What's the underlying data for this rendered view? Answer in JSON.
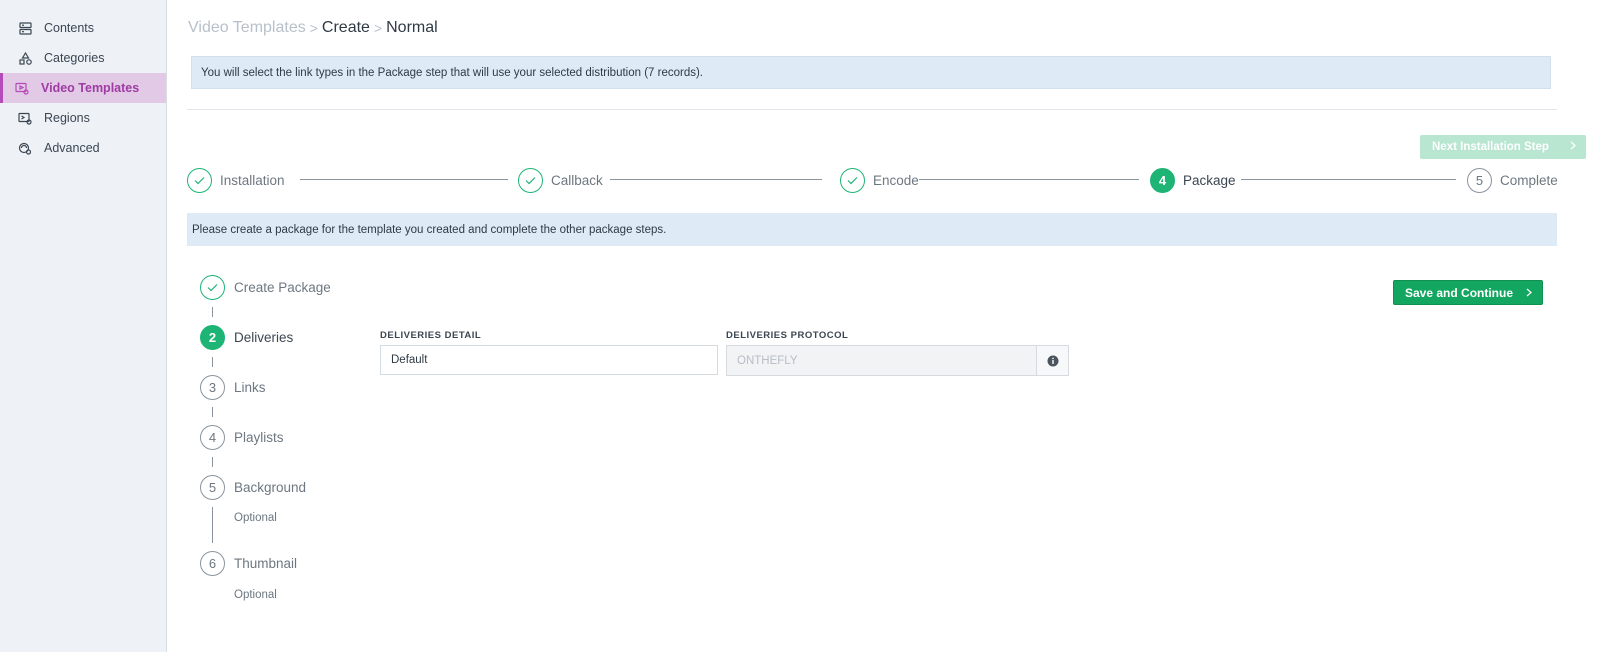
{
  "sidebar": {
    "items": [
      {
        "label": "Contents",
        "icon": "server-stack-icon"
      },
      {
        "label": "Categories",
        "icon": "shapes-icon"
      },
      {
        "label": "Video Templates",
        "icon": "video-settings-icon"
      },
      {
        "label": "Regions",
        "icon": "region-settings-icon"
      },
      {
        "label": "Advanced",
        "icon": "advanced-settings-icon"
      }
    ],
    "active_index": 2
  },
  "breadcrumb": {
    "level1": "Video Templates",
    "sep": ">",
    "level2": "Create",
    "level3": "Normal"
  },
  "info_banner": "You will select the link types in the Package step that will use your selected distribution (7 records).",
  "next_step_button": "Next Installation Step",
  "stepper": [
    {
      "label": "Installation",
      "state": "done"
    },
    {
      "label": "Callback",
      "state": "done"
    },
    {
      "label": "Encode",
      "state": "done"
    },
    {
      "label": "Package",
      "state": "active",
      "number": "4"
    },
    {
      "label": "Complete",
      "state": "pending",
      "number": "5"
    }
  ],
  "package_banner": "Please create a package for the template you created and complete the other package steps.",
  "substeps": [
    {
      "label": "Create Package",
      "state": "done"
    },
    {
      "label": "Deliveries",
      "state": "active",
      "number": "2"
    },
    {
      "label": "Links",
      "state": "pending",
      "number": "3"
    },
    {
      "label": "Playlists",
      "state": "pending",
      "number": "4"
    },
    {
      "label": "Background",
      "state": "pending",
      "number": "5",
      "note": "Optional"
    },
    {
      "label": "Thumbnail",
      "state": "pending",
      "number": "6",
      "note": "Optional"
    }
  ],
  "save_button": "Save and Continue",
  "deliveries_detail": {
    "label": "DELIVERIES DETAIL",
    "value": "Default"
  },
  "deliveries_protocol": {
    "label": "DELIVERIES PROTOCOL",
    "value": "ONTHEFLY"
  },
  "colors": {
    "accent": "#1db475",
    "active_nav": "#b54bb8",
    "banner": "#deeaf5",
    "save": "#13a660"
  }
}
